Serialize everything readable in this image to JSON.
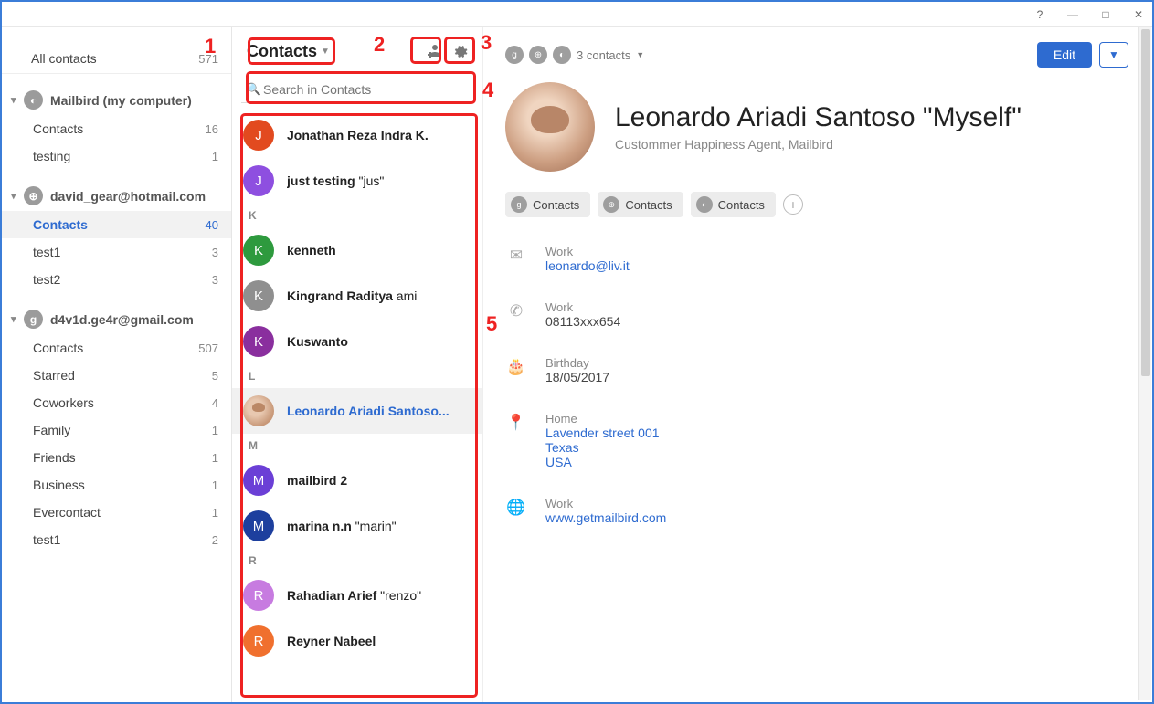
{
  "titlebar": {
    "help": "?",
    "min": "—",
    "max": "□",
    "close": "✕"
  },
  "sidebar": {
    "all": {
      "label": "All contacts",
      "count": "571"
    },
    "groups": [
      {
        "icon": "◐",
        "title": "Mailbird (my computer)",
        "items": [
          {
            "label": "Contacts",
            "count": "16"
          },
          {
            "label": "testing",
            "count": "1"
          }
        ]
      },
      {
        "icon": "⊕",
        "title": "david_gear@hotmail.com",
        "items": [
          {
            "label": "Contacts",
            "count": "40",
            "active": true
          },
          {
            "label": "test1",
            "count": "3"
          },
          {
            "label": "test2",
            "count": "3"
          }
        ]
      },
      {
        "icon": "g",
        "title": "d4v1d.ge4r@gmail.com",
        "items": [
          {
            "label": "Contacts",
            "count": "507"
          },
          {
            "label": "Starred",
            "count": "5"
          },
          {
            "label": "Coworkers",
            "count": "4"
          },
          {
            "label": "Family",
            "count": "1"
          },
          {
            "label": "Friends",
            "count": "1"
          },
          {
            "label": "Business",
            "count": "1"
          },
          {
            "label": "Evercontact",
            "count": "1"
          },
          {
            "label": "test1",
            "count": "2"
          }
        ]
      }
    ]
  },
  "list": {
    "title": "Contacts",
    "search_placeholder": "Search in Contacts",
    "rows": [
      {
        "type": "item",
        "initial": "J",
        "color": "#e24a1f",
        "bold": "Jonathan Reza Indra K.",
        "rest": ""
      },
      {
        "type": "item",
        "initial": "J",
        "color": "#8e4fe0",
        "bold": "just testing",
        "rest": " \"jus\""
      },
      {
        "type": "letter",
        "text": "K"
      },
      {
        "type": "item",
        "initial": "K",
        "color": "#2e9a3e",
        "bold": "kenneth",
        "rest": ""
      },
      {
        "type": "item",
        "initial": "K",
        "color": "#8f8f8f",
        "bold": "Kingrand Raditya",
        "rest": " ami"
      },
      {
        "type": "item",
        "initial": "K",
        "color": "#8a2f9e",
        "bold": "Kuswanto",
        "rest": ""
      },
      {
        "type": "letter",
        "text": "L"
      },
      {
        "type": "item",
        "selected": true,
        "img": true,
        "bold": "Leonardo Ariadi Santoso...",
        "rest": ""
      },
      {
        "type": "letter",
        "text": "M"
      },
      {
        "type": "item",
        "initial": "M",
        "color": "#6b3fd6",
        "bold": "mailbird 2",
        "rest": ""
      },
      {
        "type": "item",
        "initial": "M",
        "color": "#1d3f9e",
        "bold": "marina n.n",
        "rest": " \"marin\""
      },
      {
        "type": "letter",
        "text": "R"
      },
      {
        "type": "item",
        "initial": "R",
        "color": "#c77be0",
        "bold": "Rahadian Arief",
        "rest": " \"renzo\""
      },
      {
        "type": "item",
        "initial": "R",
        "color": "#f0702e",
        "bold": "Reyner Nabeel",
        "rest": ""
      }
    ]
  },
  "detail": {
    "source_summary": "3 contacts",
    "edit": "Edit",
    "name": "Leonardo Ariadi Santoso \"Myself\"",
    "subtitle": "Custommer Happiness Agent, Mailbird",
    "sources": [
      {
        "icon": "g",
        "label": "Contacts"
      },
      {
        "icon": "⊕",
        "label": "Contacts"
      },
      {
        "icon": "◐",
        "label": "Contacts"
      }
    ],
    "fields": [
      {
        "icon": "✉",
        "label": "Work",
        "value": "leonardo@liv.it",
        "link": true
      },
      {
        "icon": "✆",
        "label": "Work",
        "value": "08113xxx654",
        "link": false
      },
      {
        "icon": "🎂",
        "label": "Birthday",
        "value": "18/05/2017",
        "link": false
      },
      {
        "icon": "📍",
        "label": "Home",
        "value": "Lavender street 001\nTexas\nUSA",
        "link": true
      },
      {
        "icon": "🌐",
        "label": "Work",
        "value": "www.getmailbird.com",
        "link": true
      }
    ]
  },
  "callouts": {
    "n1": "1",
    "n2": "2",
    "n3": "3",
    "n4": "4",
    "n5": "5"
  }
}
